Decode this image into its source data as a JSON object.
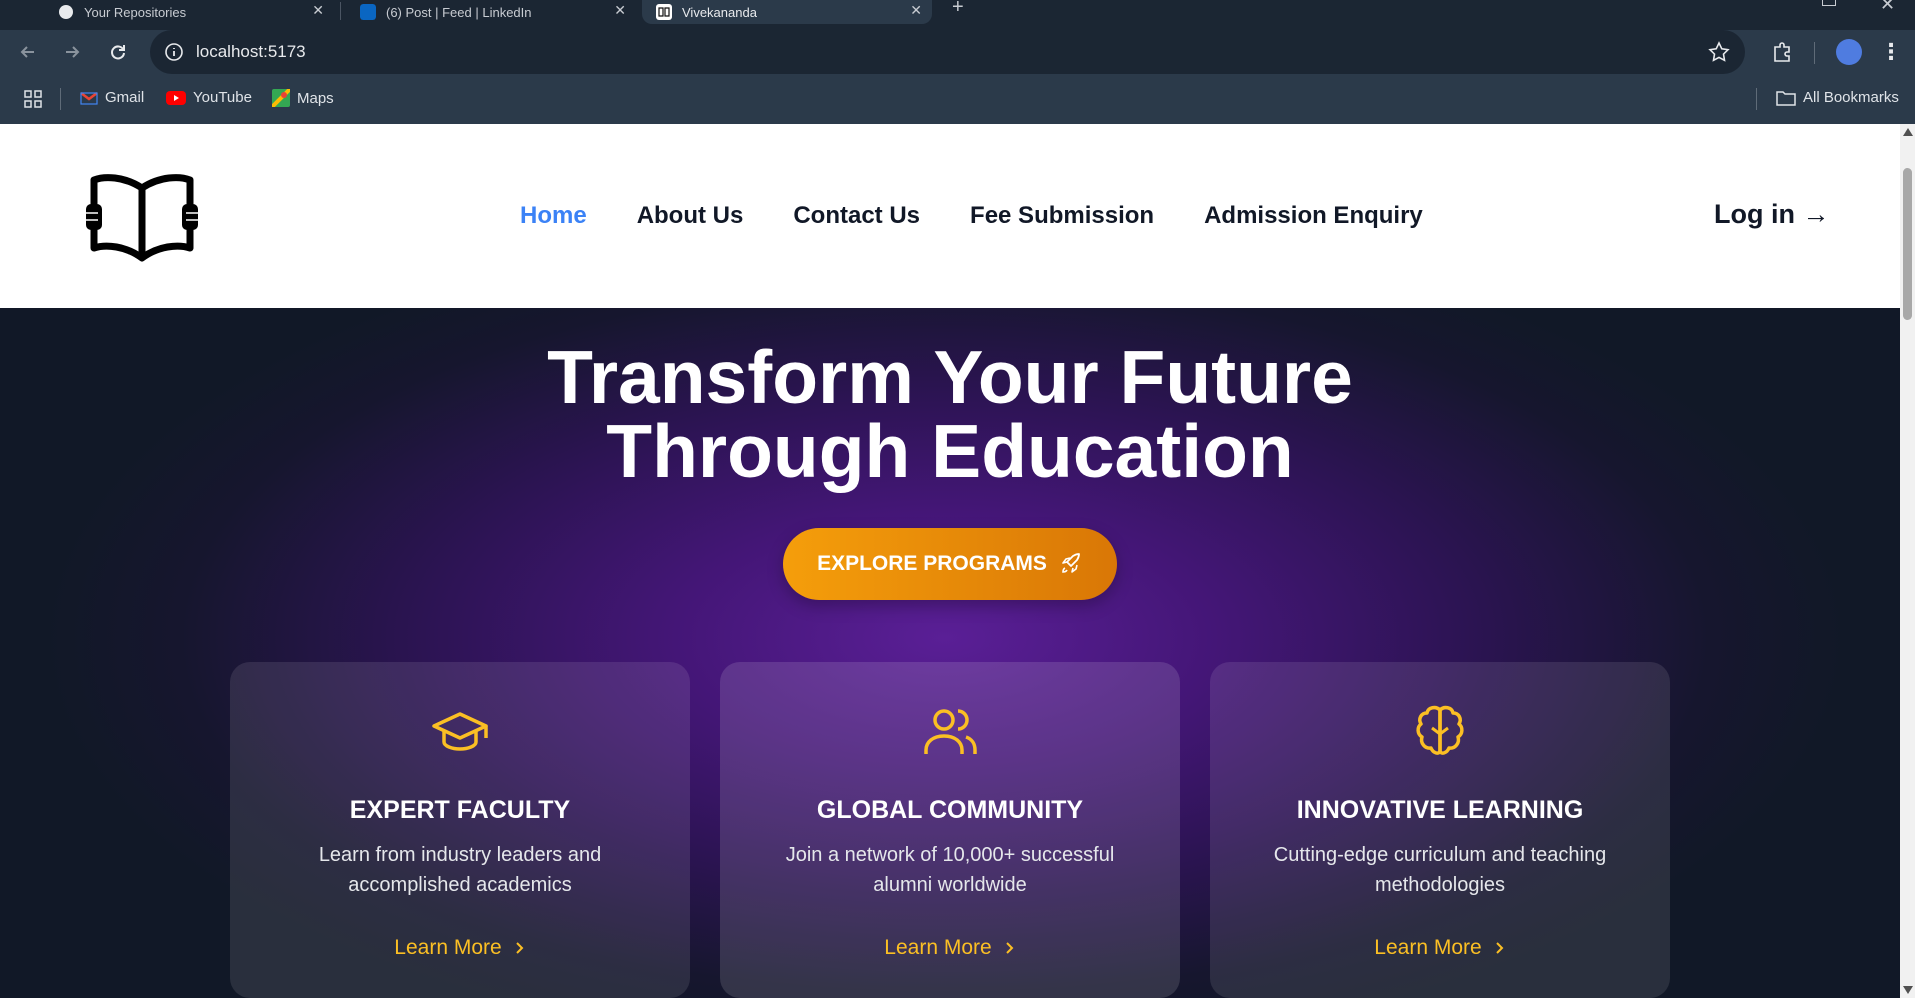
{
  "browser": {
    "tabs": [
      {
        "title": "Your Repositories",
        "active": false
      },
      {
        "title": "(6) Post | Feed | LinkedIn",
        "active": false
      },
      {
        "title": "Vivekananda",
        "active": true
      }
    ],
    "new_tab_label": "+",
    "url": "localhost:5173",
    "bookmarks": [
      {
        "label": "Gmail",
        "icon": "gmail-icon"
      },
      {
        "label": "YouTube",
        "icon": "youtube-icon"
      },
      {
        "label": "Maps",
        "icon": "maps-icon"
      }
    ],
    "all_bookmarks_label": "All Bookmarks"
  },
  "header": {
    "logo_icon": "open-book-icon",
    "nav": [
      {
        "label": "Home",
        "active": true
      },
      {
        "label": "About Us",
        "active": false
      },
      {
        "label": "Contact Us",
        "active": false
      },
      {
        "label": "Fee Submission",
        "active": false
      },
      {
        "label": "Admission Enquiry",
        "active": false
      }
    ],
    "login_label": "Log in",
    "login_arrow": "→"
  },
  "hero": {
    "title_line1": "Transform Your Future",
    "title_line2": "Through Education",
    "cta_label": "EXPLORE PROGRAMS",
    "cta_icon": "rocket-icon"
  },
  "features": [
    {
      "icon": "graduation-cap-icon",
      "title": "EXPERT FACULTY",
      "desc": "Learn from industry leaders and accomplished academics",
      "link": "Learn More"
    },
    {
      "icon": "users-icon",
      "title": "GLOBAL COMMUNITY",
      "desc": "Join a network of 10,000+ successful alumni worldwide",
      "link": "Learn More"
    },
    {
      "icon": "brain-icon",
      "title": "INNOVATIVE LEARNING",
      "desc": "Cutting-edge curriculum and teaching methodologies",
      "link": "Learn More"
    }
  ],
  "colors": {
    "accent_orange": "#f59e0b",
    "nav_active": "#3b82f6",
    "link_yellow": "#fbbf24",
    "hero_purple": "#5a1f96"
  }
}
